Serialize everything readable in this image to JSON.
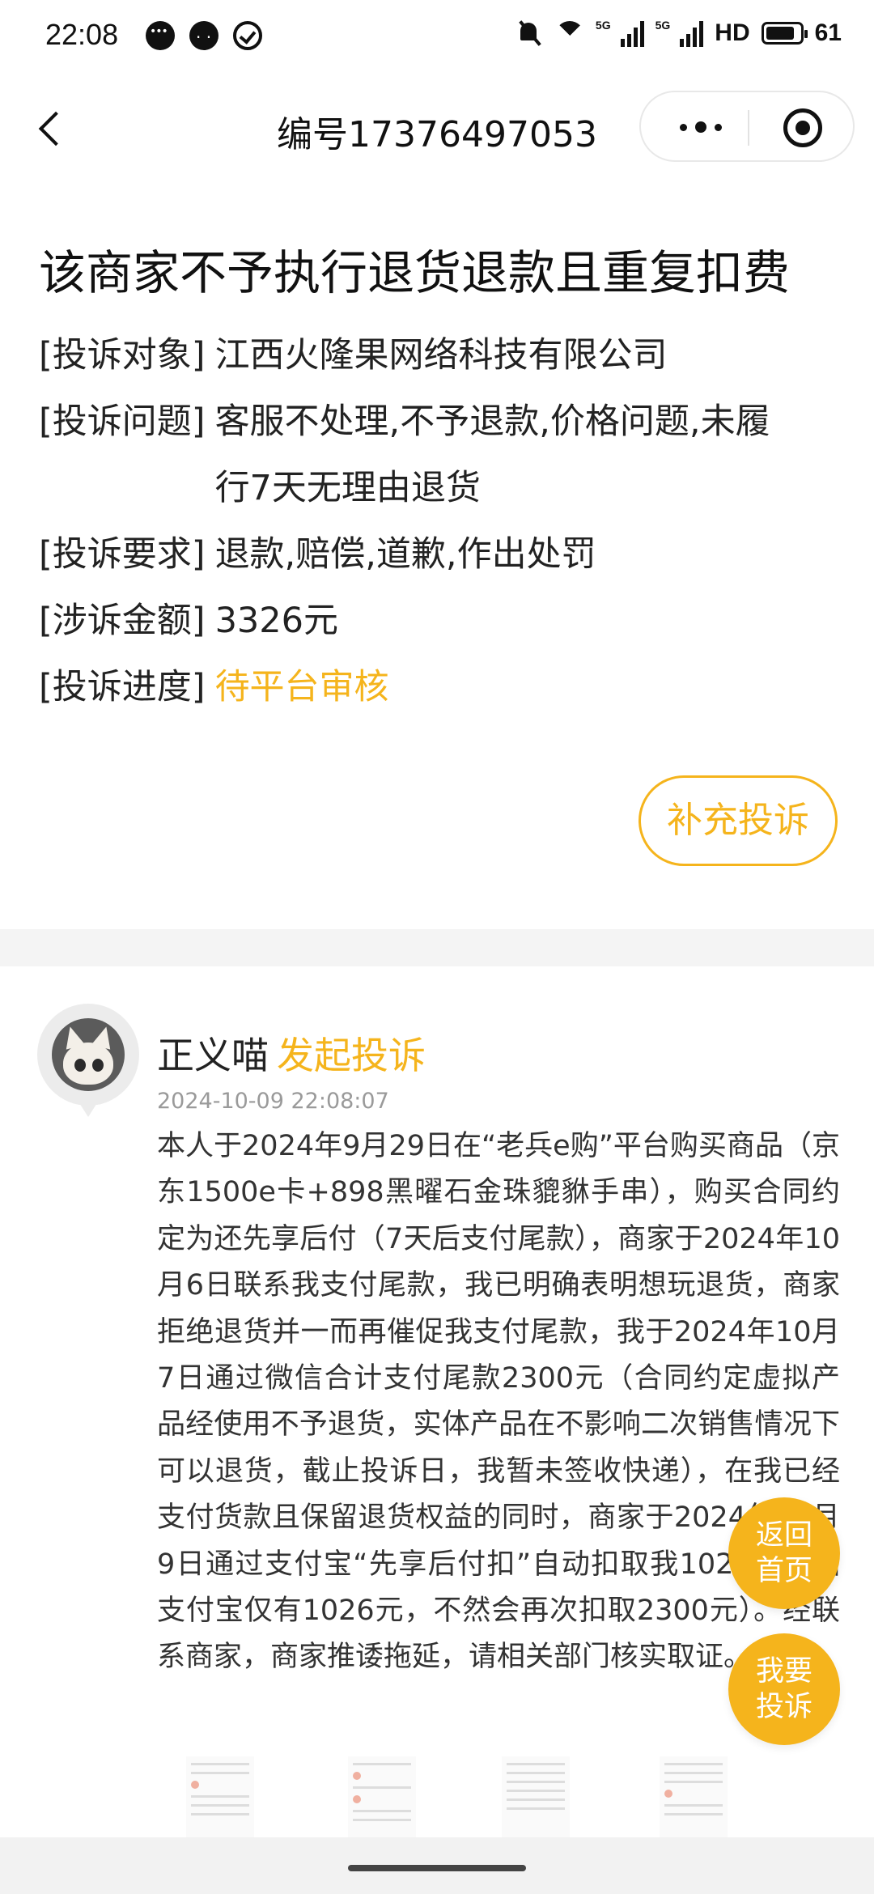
{
  "status_bar": {
    "time": "22:08",
    "hd_label": "HD",
    "net1": "5G",
    "net2": "5G",
    "battery": "61"
  },
  "nav": {
    "title": "编号17376497053"
  },
  "complaint": {
    "title": "该商家不予执行退货退款且重复扣费",
    "rows": [
      {
        "label": "[投诉对象]",
        "value": "江西火隆果网络科技有限公司"
      },
      {
        "label": "[投诉问题]",
        "value": "客服不处理,不予退款,价格问题,未履行7天无理由退货"
      },
      {
        "label": "[投诉要求]",
        "value": "退款,赔偿,道歉,作出处罚"
      },
      {
        "label": "[涉诉金额]",
        "value": "3326元"
      },
      {
        "label": "[投诉进度]",
        "value": "待平台审核"
      }
    ],
    "supplement_label": "补充投诉"
  },
  "post": {
    "author": "正义喵",
    "action": "发起投诉",
    "time": "2024-10-09 22:08:07",
    "body": "本人于2024年9月29日在“老兵e购”平台购买商品（京东1500e卡+898黑曜石金珠貔貅手串），购买合同约定为还先享后付（7天后支付尾款），商家于2024年10月6日联系我支付尾款，我已明确表明想玩退货，商家拒绝退货并一而再催促我支付尾款，我于2024年10月7日通过微信合计支付尾款2300元（合同约定虚拟产品经使用不予退货，实体产品在不影响二次销售情况下可以退货，截止投诉日，我暂未签收快递），在我已经支付货款且保留退货权益的同时，商家于2024年10月9日通过支付宝“先享后付扣”自动扣取我1026元（因支付宝仅有1026元，不然会再次扣取2300元）。经联系商家，商家推诿拖延，请相关部门核实取证。"
  },
  "float_buttons": {
    "home": "返回首页",
    "complain": "我要投诉"
  },
  "colors": {
    "accent": "#f5b41c",
    "divider": "#f4f4f4"
  }
}
